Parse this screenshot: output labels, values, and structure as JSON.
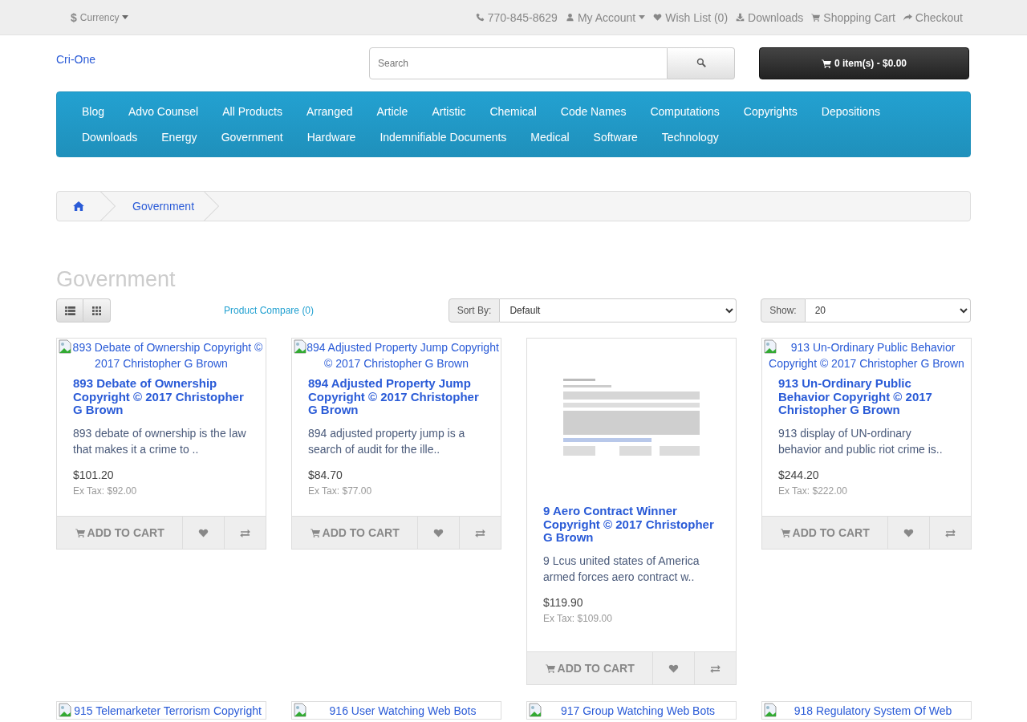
{
  "top_bar": {
    "currency": {
      "symbol": "$",
      "label": "Currency"
    },
    "phone": "770-845-8629",
    "links": [
      {
        "kind": "account",
        "label": "My Account",
        "dropdown": true
      },
      {
        "kind": "wishlist",
        "label": "Wish List (0)",
        "dropdown": false
      },
      {
        "kind": "downloads",
        "label": "Downloads",
        "dropdown": false
      },
      {
        "kind": "cart",
        "label": "Shopping Cart",
        "dropdown": false
      },
      {
        "kind": "checkout",
        "label": "Checkout",
        "dropdown": false
      }
    ]
  },
  "header": {
    "logo_alt": "Cri-One",
    "search": {
      "placeholder": "Search"
    },
    "cart_button": "0 item(s) - $0.00"
  },
  "menu": {
    "items": [
      "Blog",
      "Advo Counsel",
      "All Products",
      "Arranged",
      "Article",
      "Artistic",
      "Chemical",
      "Code Names",
      "Computations",
      "Copyrights",
      "Depositions",
      "Downloads",
      "Energy",
      "Government",
      "Hardware",
      "Indemnifiable Documents",
      "Medical",
      "Software",
      "Technology"
    ]
  },
  "breadcrumb": [
    "Government"
  ],
  "heading": "Government",
  "toolbar": {
    "compare_link": "Product Compare (0)",
    "sort_label": "Sort By:",
    "sort_value": "Default",
    "show_label": "Show:",
    "show_value": "20"
  },
  "products": [
    {
      "kind": "broken",
      "alt": "893 Debate of Ownership Copyright © 2017 Christopher G Brown",
      "name": "893 Debate of Ownership Copyright © 2017 Christopher G Brown",
      "description": "893 debate of ownership is the law that makes it a crime to ..",
      "price": "$101.20",
      "ex_tax": "Ex Tax: $92.00",
      "cart_label": "ADD TO CART"
    },
    {
      "kind": "broken",
      "alt": "894 Adjusted Property Jump Copyright © 2017 Christopher G Brown",
      "name": "894 Adjusted Property Jump Copyright © 2017 Christopher G Brown",
      "description": "894 adjusted property jump is a search of audit for the ille..",
      "price": "$84.70",
      "ex_tax": "Ex Tax: $77.00",
      "cart_label": "ADD TO CART"
    },
    {
      "kind": "picture",
      "name": "9 Aero Contract Winner Copyright © 2017 Christopher G Brown",
      "description": "9 Lcus united states of America armed forces aero contract w..",
      "price": "$119.90",
      "ex_tax": "Ex Tax: $109.00",
      "cart_label": "ADD TO CART"
    },
    {
      "kind": "broken",
      "alt": "913 Un-Ordinary Public Behavior Copyright © 2017 Christopher G Brown",
      "name": "913 Un-Ordinary Public Behavior Copyright © 2017 Christopher G Brown",
      "description": "913 display of UN-ordinary behavior and public riot crime is..",
      "price": "$244.20",
      "ex_tax": "Ex Tax: $222.00",
      "cart_label": "ADD TO CART"
    }
  ],
  "next_row": [
    {
      "alt": "915 Telemarketer Terrorism Copyright"
    },
    {
      "alt": "916 User Watching Web Bots"
    },
    {
      "alt": "917 Group Watching Web Bots"
    },
    {
      "alt": "918 Regulatory System Of Web"
    }
  ]
}
